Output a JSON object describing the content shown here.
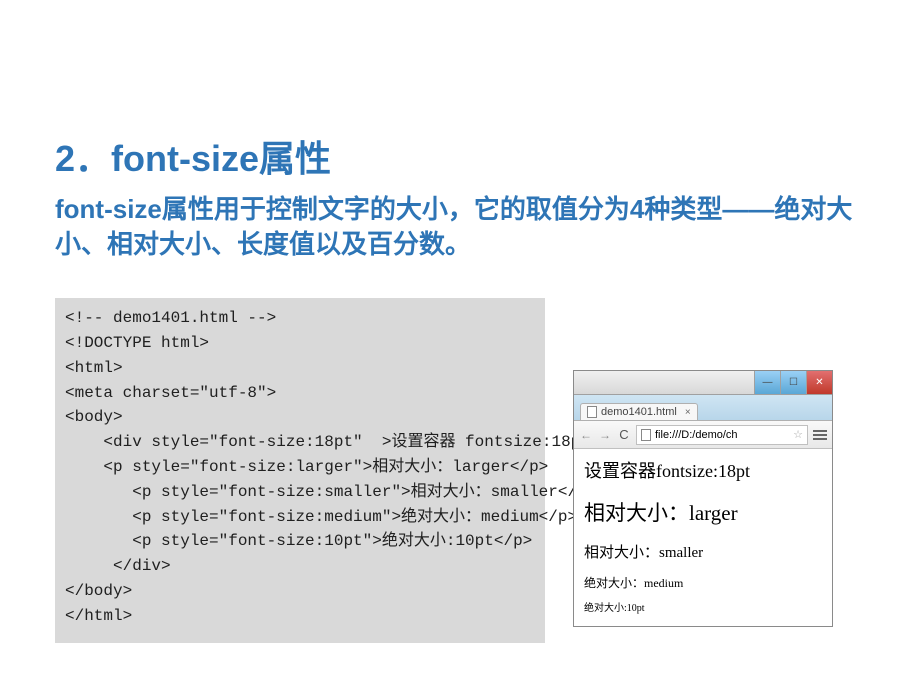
{
  "heading": "2．font-size属性",
  "subheading": "font-size属性用于控制文字的大小，它的取值分为4种类型——绝对大小、相对大小、长度值以及百分数。",
  "code": "<!-- demo1401.html -->\n<!DOCTYPE html>\n<html>\n<meta charset=\"utf-8\">\n<body>\n    <div style=\"font-size:18pt\"  >设置容器 fontsize:18pt\n    <p style=\"font-size:larger\">相对大小：larger</p>\n       <p style=\"font-size:smaller\">相对大小：smaller</p>\n       <p style=\"font-size:medium\">绝对大小：medium</p>\n       <p style=\"font-size:10pt\">绝对大小:10pt</p>\n     </div>\n</body>\n</html>",
  "browser": {
    "tab_title": "demo1401.html",
    "url_prefix": "file:///D:/demo/ch",
    "lines": {
      "l1": "设置容器fontsize:18pt",
      "l2": "相对大小：larger",
      "l3": "相对大小：smaller",
      "l4": "绝对大小：medium",
      "l5": "绝对大小:10pt"
    },
    "buttons": {
      "min": "—",
      "max": "☐",
      "close": "✕",
      "back": "←",
      "forward": "→",
      "reload": "C",
      "tab_close": "×",
      "star": "☆"
    }
  }
}
